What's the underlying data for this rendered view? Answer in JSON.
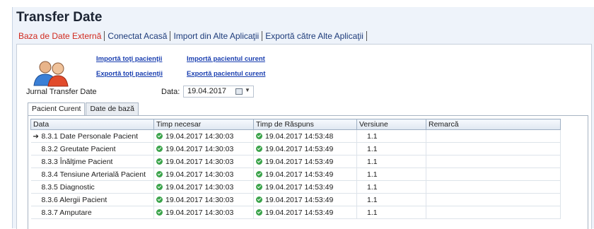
{
  "window": {
    "title": "Transfer Date"
  },
  "top_tabs": [
    {
      "label": "Baza de Date Externă",
      "active": true
    },
    {
      "label": "Conectat Acasă",
      "active": false
    },
    {
      "label": "Import din Alte Aplicaţii",
      "active": false
    },
    {
      "label": "Exportă către Alte Aplicaţii",
      "active": false
    }
  ],
  "links": {
    "import_all": "Importă toţi pacienţii",
    "import_current": "Importă pacientul curent",
    "export_all": "Exportă toţi pacienţii",
    "export_current": "Exportă pacientul curent"
  },
  "journal": {
    "label": "Jurnal Transfer Date",
    "date_label": "Data:",
    "date_value": "19.04.2017"
  },
  "sub_tabs": [
    {
      "label": "Pacient Curent",
      "active": true
    },
    {
      "label": "Date de bază",
      "active": false
    }
  ],
  "table": {
    "columns": [
      "Data",
      "Timp necesar",
      "Timp de Răspuns",
      "Versiune",
      "Remarcă"
    ],
    "rows": [
      {
        "selected": true,
        "data": "8.3.1 Date Personale Pacient",
        "timp_necesar": "19.04.2017 14:30:03",
        "timp_raspuns": "19.04.2017 14:53:48",
        "versiune": "1.1",
        "remarca": ""
      },
      {
        "selected": false,
        "data": "8.3.2 Greutate Pacient",
        "timp_necesar": "19.04.2017 14:30:03",
        "timp_raspuns": "19.04.2017 14:53:49",
        "versiune": "1.1",
        "remarca": ""
      },
      {
        "selected": false,
        "data": "8.3.3 Înălţime Pacient",
        "timp_necesar": "19.04.2017 14:30:03",
        "timp_raspuns": "19.04.2017 14:53:49",
        "versiune": "1.1",
        "remarca": ""
      },
      {
        "selected": false,
        "data": "8.3.4 Tensiune Arterială Pacient",
        "timp_necesar": "19.04.2017 14:30:03",
        "timp_raspuns": "19.04.2017 14:53:49",
        "versiune": "1.1",
        "remarca": ""
      },
      {
        "selected": false,
        "data": "8.3.5 Diagnostic",
        "timp_necesar": "19.04.2017 14:30:03",
        "timp_raspuns": "19.04.2017 14:53:49",
        "versiune": "1.1",
        "remarca": ""
      },
      {
        "selected": false,
        "data": "8.3.6 Alergii Pacient",
        "timp_necesar": "19.04.2017 14:30:03",
        "timp_raspuns": "19.04.2017 14:53:49",
        "versiune": "1.1",
        "remarca": ""
      },
      {
        "selected": false,
        "data": "8.3.7 Amputare",
        "timp_necesar": "19.04.2017 14:30:03",
        "timp_raspuns": "19.04.2017 14:53:49",
        "versiune": "1.1",
        "remarca": ""
      }
    ]
  },
  "icons": {
    "users": "users-icon",
    "status": "check-circle-icon",
    "calendar": "calendar-icon",
    "row_pointer": "arrow-right-icon"
  },
  "colors": {
    "active_tab": "#d12a1f",
    "link": "#1a3fb0",
    "status_ok": "#3aa34a"
  }
}
